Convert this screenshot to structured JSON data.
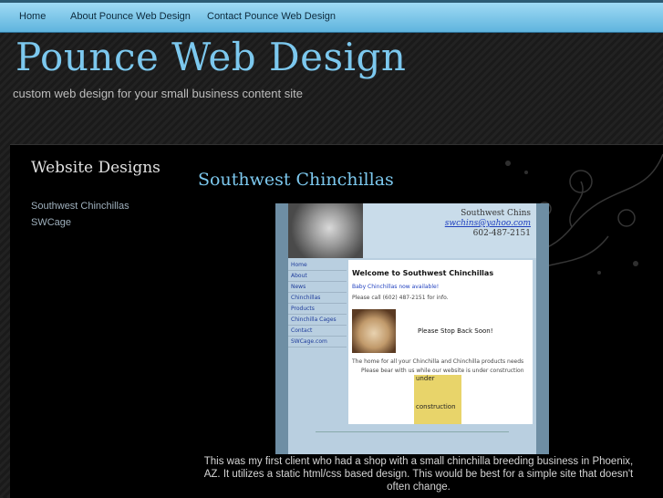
{
  "nav": {
    "items": [
      "Home",
      "About Pounce Web Design",
      "Contact Pounce Web Design"
    ]
  },
  "site": {
    "title": "Pounce Web Design",
    "tagline": "custom web design for your small business content site"
  },
  "sidebar": {
    "heading": "Website Designs",
    "links": [
      "Southwest Chinchillas",
      "SWCage"
    ]
  },
  "main": {
    "heading": "Southwest Chinchillas",
    "screenshot": {
      "brand": "Southwest Chins",
      "email": "swchins@yahoo.com",
      "phone": "602-487-2151",
      "nav": [
        "Home",
        "About",
        "News",
        "Chinchillas",
        "Products",
        "Chinchilla Cages",
        "Contact",
        "SWCage.com"
      ],
      "welcome": "Welcome to Southwest Chinchillas",
      "line1": "Baby Chinchillas now available!",
      "line2": "Please call (602) 487-2151 for info.",
      "back_soon": "Please Stop Back Soon!",
      "line3": "The home for all your Chinchilla and Chinchilla products needs",
      "line4": "Please bear with us while our website is under construction",
      "under1": "under",
      "under2": "construction"
    },
    "caption": "This was my first client who had a shop with a small chinchilla breeding business in Phoenix, AZ.  It utilizes a static html/css based design.  This would be best for a simple site that doesn't often change."
  },
  "colors": {
    "accent": "#7cc8ee",
    "nav_bg": "#7cc8ee",
    "body_bg": "#1e1e1e"
  }
}
